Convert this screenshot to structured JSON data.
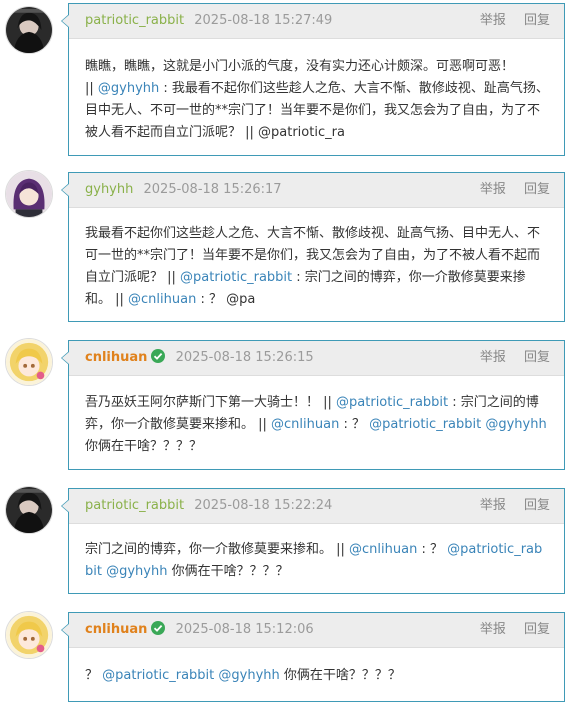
{
  "colors": {
    "border": "#3f9ab6",
    "header_bg": "#ededed",
    "link": "#3a84b8",
    "user_green": "#8ab14a",
    "user_orange": "#e0821d"
  },
  "actions": {
    "report": "举报",
    "reply": "回复"
  },
  "comments": [
    {
      "user": "patriotic_rabbit",
      "time": "2025-08-18 15:27:49",
      "verified": false,
      "line1": "瞧瞧，瞧瞧，这就是小门小派的气度，没有实力还心计颇深。可恶啊可恶！",
      "sep1": "|| ",
      "mention1": "@gyhyhh",
      "text2": " : 我最看不起你们这些趁人之危、大言不惭、散修歧视、趾高气扬、目中无人、不可一世的**宗门了！当年要不是你们，我又怎会为了自由，为了不被人看不起而自立门派呢？ || @patriotic_ra"
    },
    {
      "user": "gyhyhh",
      "time": "2025-08-18 15:26:17",
      "verified": false,
      "text1": "我最看不起你们这些趁人之危、大言不惭、散修歧视、趾高气扬、目中无人、不可一世的**宗门了！当年要不是你们，我又怎会为了自由，为了不被人看不起而自立门派呢？ || ",
      "mention1": "@patriotic_rabbit",
      "text2": " : 宗门之间的博弈，你一介散修莫要来掺和。 || ",
      "mention2": "@cnlihuan",
      "text3": " : ？ @pa"
    },
    {
      "user": "cnlihuan",
      "time": "2025-08-18 15:26:15",
      "verified": true,
      "text1": "吾乃巫妖王阿尔萨斯门下第一大骑士！！ || ",
      "mention1": "@patriotic_rabbit",
      "text2": " : 宗门之间的博弈，你一介散修莫要来掺和。 || ",
      "mention2": "@cnlihuan",
      "text3": " : ？ ",
      "mention3": "@patriotic_rabbit",
      "text4": " ",
      "mention4": "@gyhyhh",
      "text5": " 你俩在干啥？？？？"
    },
    {
      "user": "patriotic_rabbit",
      "time": "2025-08-18 15:22:24",
      "verified": false,
      "text1": "宗门之间的博弈，你一介散修莫要来掺和。 || ",
      "mention1": "@cnlihuan",
      "text2": " : ？ ",
      "mention2": "@patriotic_rabbit",
      "text3": " ",
      "mention3": "@gyhyhh",
      "text4": " 你俩在干啥？？？？"
    },
    {
      "user": "cnlihuan",
      "time": "2025-08-18 15:12:06",
      "verified": true,
      "text1": "？ ",
      "mention1": "@patriotic_rabbit",
      "text2": " ",
      "mention2": "@gyhyhh",
      "text3": " 你俩在干啥？？？？"
    }
  ]
}
